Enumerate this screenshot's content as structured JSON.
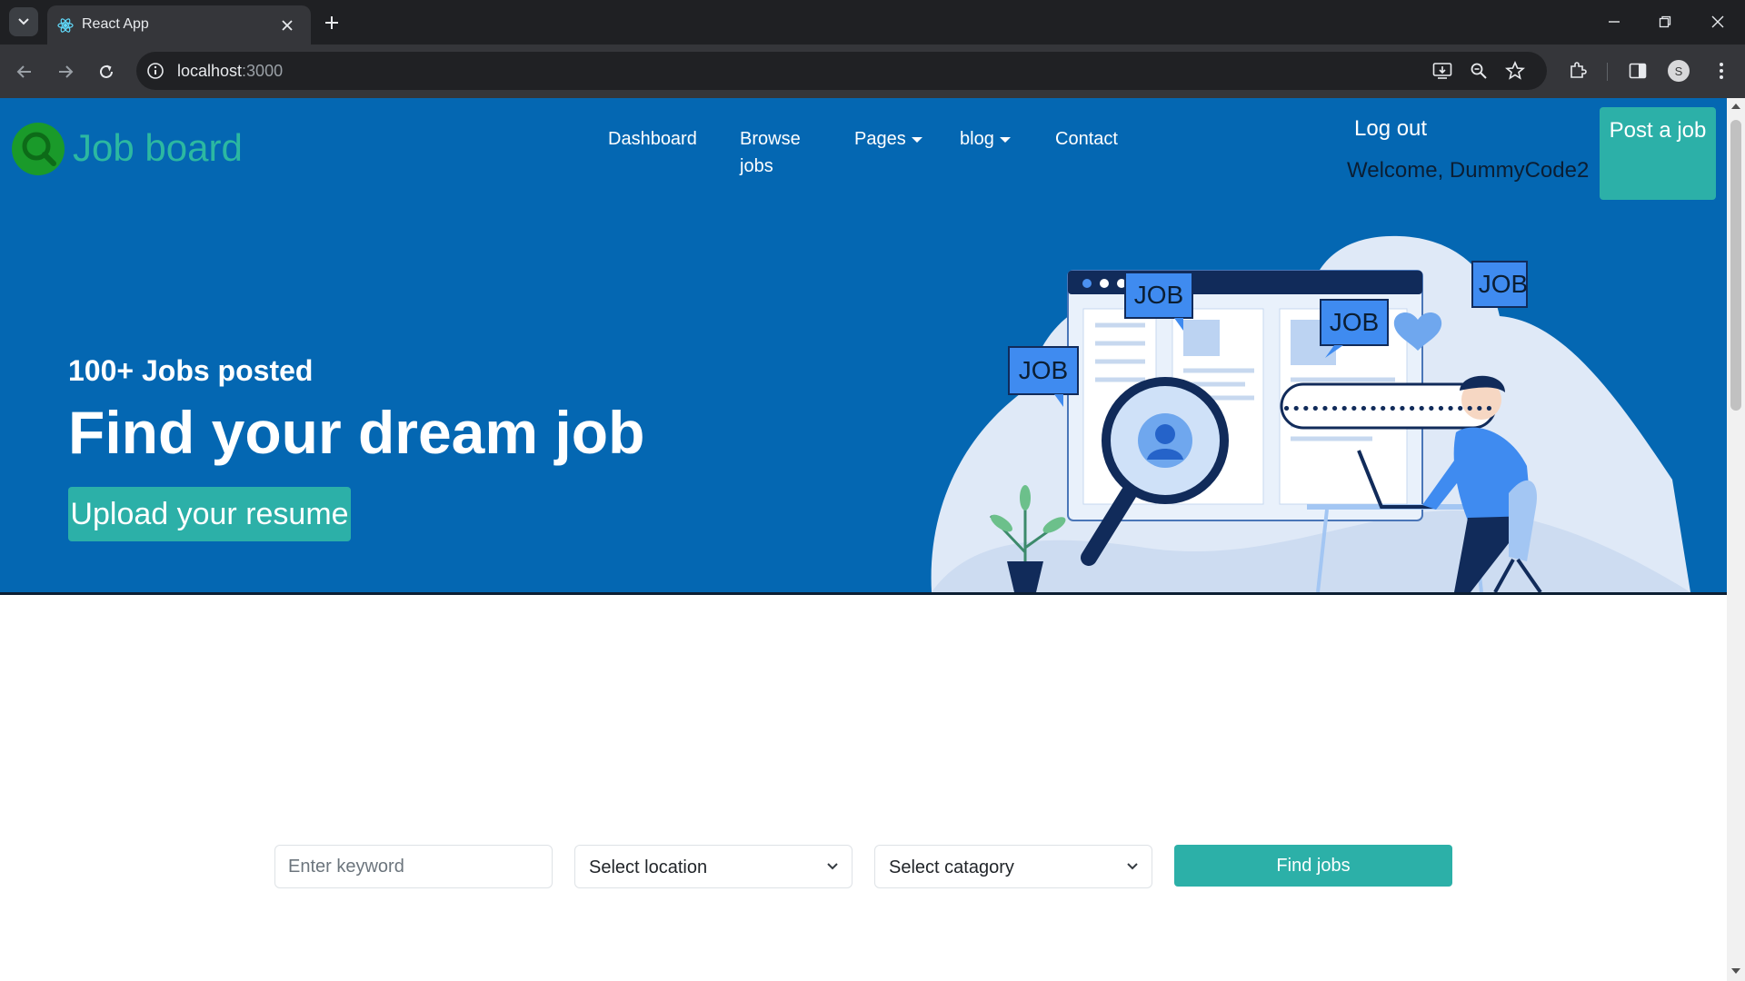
{
  "browser": {
    "tab_title": "React App",
    "url_host": "localhost",
    "url_port": ":3000",
    "profile_initial": "S"
  },
  "header": {
    "logo_text": "Job board",
    "nav": [
      {
        "label": "Dashboard"
      },
      {
        "label": "Browse jobs"
      },
      {
        "label": "Pages"
      },
      {
        "label": "blog"
      },
      {
        "label": "Contact"
      }
    ],
    "logout_label": "Log out",
    "welcome_text": "Welcome, DummyCode2",
    "post_job_label": "Post a job"
  },
  "hero": {
    "subtitle": "100+ Jobs posted",
    "title": "Find your dream job",
    "upload_label": "Upload your resume",
    "bubble_label": "JOB",
    "password_dots": "••••••••••••••••••••••"
  },
  "search": {
    "keyword_placeholder": "Enter keyword",
    "location_label": "Select location",
    "category_label": "Select catagory",
    "find_label": "Find jobs"
  },
  "colors": {
    "header_bg": "#0467b2",
    "accent": "#2cb0a8",
    "logo_text": "#2cb8a1",
    "logo_icon": "#1a9a2a"
  }
}
